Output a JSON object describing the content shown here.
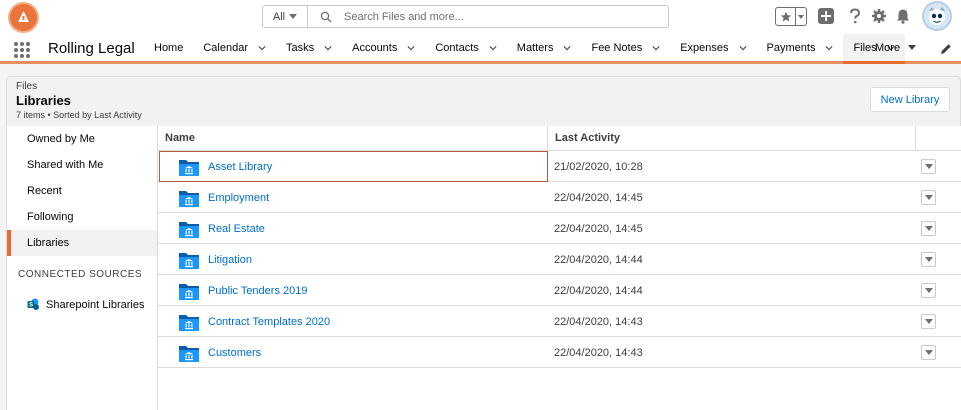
{
  "header": {
    "search": {
      "scope": "All",
      "placeholder": "Search Files and more..."
    },
    "icons": [
      "favorites-star-icon",
      "add-icon",
      "help-icon",
      "setup-gear-icon",
      "notifications-bell-icon",
      "user-avatar"
    ]
  },
  "nav": {
    "app_name": "Rolling Legal",
    "items": [
      {
        "label": "Home",
        "has_menu": false
      },
      {
        "label": "Calendar",
        "has_menu": true
      },
      {
        "label": "Tasks",
        "has_menu": true
      },
      {
        "label": "Accounts",
        "has_menu": true
      },
      {
        "label": "Contacts",
        "has_menu": true
      },
      {
        "label": "Matters",
        "has_menu": true
      },
      {
        "label": "Fee Notes",
        "has_menu": true
      },
      {
        "label": "Expenses",
        "has_menu": true
      },
      {
        "label": "Payments",
        "has_menu": true
      },
      {
        "label": "Files",
        "has_menu": true,
        "active": true
      }
    ],
    "more_label": "More"
  },
  "page_header": {
    "object_label": "Files",
    "title": "Libraries",
    "meta": "7 items • Sorted by Last Activity",
    "new_button": "New Library"
  },
  "sidebar": {
    "items": [
      {
        "label": "Owned by Me",
        "active": false
      },
      {
        "label": "Shared with Me",
        "active": false
      },
      {
        "label": "Recent",
        "active": false
      },
      {
        "label": "Following",
        "active": false
      },
      {
        "label": "Libraries",
        "active": true
      }
    ],
    "connected_heading": "CONNECTED SOURCES",
    "sources": [
      {
        "label": "Sharepoint Libraries"
      }
    ]
  },
  "table": {
    "columns": [
      "Name",
      "Last Activity"
    ],
    "rows": [
      {
        "name": "Asset Library",
        "last_activity": "21/02/2020, 10:28",
        "selected": true
      },
      {
        "name": "Employment",
        "last_activity": "22/04/2020, 14:45"
      },
      {
        "name": "Real Estate",
        "last_activity": "22/04/2020, 14:45"
      },
      {
        "name": "Litigation",
        "last_activity": "22/04/2020, 14:44"
      },
      {
        "name": "Public Tenders 2019",
        "last_activity": "22/04/2020, 14:44"
      },
      {
        "name": "Contract Templates 2020",
        "last_activity": "22/04/2020, 14:43"
      },
      {
        "name": "Customers",
        "last_activity": "22/04/2020, 14:43"
      }
    ]
  },
  "colors": {
    "accent": "#e86c2d",
    "link": "#006dcc",
    "folder": "#1b96ff",
    "folder_dark": "#0b5cab"
  }
}
